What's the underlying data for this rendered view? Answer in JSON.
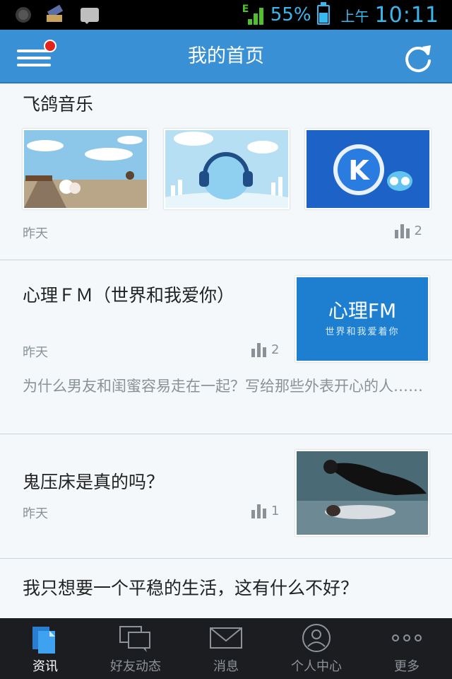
{
  "status_bar": {
    "battery_percent": "55%",
    "ampm": "上午",
    "time": "10:11",
    "signal_type": "E",
    "accent_color": "#39b8ee"
  },
  "header": {
    "title": "我的首页",
    "menu_icon": "menu-icon",
    "refresh_icon": "refresh-icon",
    "background_color": "#3a90d4"
  },
  "feed": [
    {
      "title": "飞鸽音乐",
      "date": "昨天",
      "count": "2"
    },
    {
      "title": "心理ＦＭ（世界和我爱你）",
      "date": "昨天",
      "count": "2",
      "excerpt": "为什么男友和闺蜜容易走在一起？写给那些外表开心的人……",
      "thumb_title": "心理FM",
      "thumb_subtitle": "世界和我爱着你"
    },
    {
      "title": "鬼压床是真的吗？",
      "date": "昨天",
      "count": "1"
    },
    {
      "title": "我只想要一个平稳的生活，这有什么不好？"
    }
  ],
  "tabs": [
    {
      "label": "资讯",
      "icon": "document-icon",
      "active": true
    },
    {
      "label": "好友动态",
      "icon": "chat-icon",
      "active": false
    },
    {
      "label": "消息",
      "icon": "envelope-icon",
      "active": false
    },
    {
      "label": "个人中心",
      "icon": "person-icon",
      "active": false
    },
    {
      "label": "更多",
      "icon": "more-icon",
      "active": false
    }
  ]
}
